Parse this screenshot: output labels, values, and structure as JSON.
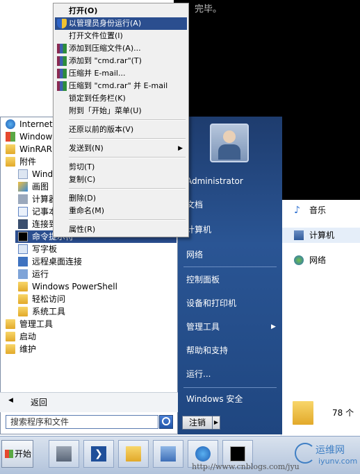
{
  "console": {
    "text": "完毕。"
  },
  "explorer": {
    "items": [
      {
        "label": "音乐"
      },
      {
        "label": "计算机"
      },
      {
        "label": "网络"
      }
    ],
    "count": "78 个"
  },
  "start_menu": {
    "programs": [
      {
        "label": "Internet"
      },
      {
        "label": "Windows"
      },
      {
        "label": "WinRAR"
      },
      {
        "label": "附件"
      },
      {
        "label": "Windo"
      },
      {
        "label": "画图"
      },
      {
        "label": "计算器"
      },
      {
        "label": "记事本"
      },
      {
        "label": "连接到"
      },
      {
        "label": "命令提示符"
      },
      {
        "label": "写字板"
      },
      {
        "label": "远程桌面连接"
      },
      {
        "label": "运行"
      },
      {
        "label": "Windows PowerShell"
      },
      {
        "label": "轻松访问"
      },
      {
        "label": "系统工具"
      },
      {
        "label": "管理工具"
      },
      {
        "label": "启动"
      },
      {
        "label": "维护"
      }
    ],
    "back_label": "返回",
    "search_placeholder": "搜索程序和文件",
    "right_items": [
      {
        "label": "Administrator"
      },
      {
        "label": "文档"
      },
      {
        "label": "计算机"
      },
      {
        "label": "网络"
      },
      {
        "label": "控制面板"
      },
      {
        "label": "设备和打印机"
      },
      {
        "label": "管理工具"
      },
      {
        "label": "帮助和支持"
      },
      {
        "label": "运行..."
      },
      {
        "label": "Windows 安全"
      }
    ],
    "shutdown_label": "注销"
  },
  "context_menu": {
    "items": [
      {
        "label": "打开(O)"
      },
      {
        "label": "以管理员身份运行(A)"
      },
      {
        "label": "打开文件位置(I)"
      },
      {
        "label": "添加到压缩文件(A)..."
      },
      {
        "label": "添加到 \"cmd.rar\"(T)"
      },
      {
        "label": "压缩并 E-mail..."
      },
      {
        "label": "压缩到 \"cmd.rar\" 并 E-mail"
      },
      {
        "label": "锁定到任务栏(K)"
      },
      {
        "label": "附到「开始」菜单(U)"
      },
      {
        "label": "还原以前的版本(V)"
      },
      {
        "label": "发送到(N)"
      },
      {
        "label": "剪切(T)"
      },
      {
        "label": "复制(C)"
      },
      {
        "label": "删除(D)"
      },
      {
        "label": "重命名(M)"
      },
      {
        "label": "属性(R)"
      }
    ]
  },
  "taskbar": {
    "start_label": "开始"
  },
  "watermark": {
    "brand": "运维网",
    "site": "iyunv.com",
    "url": "http://www.cnblogs.com/jyu"
  }
}
